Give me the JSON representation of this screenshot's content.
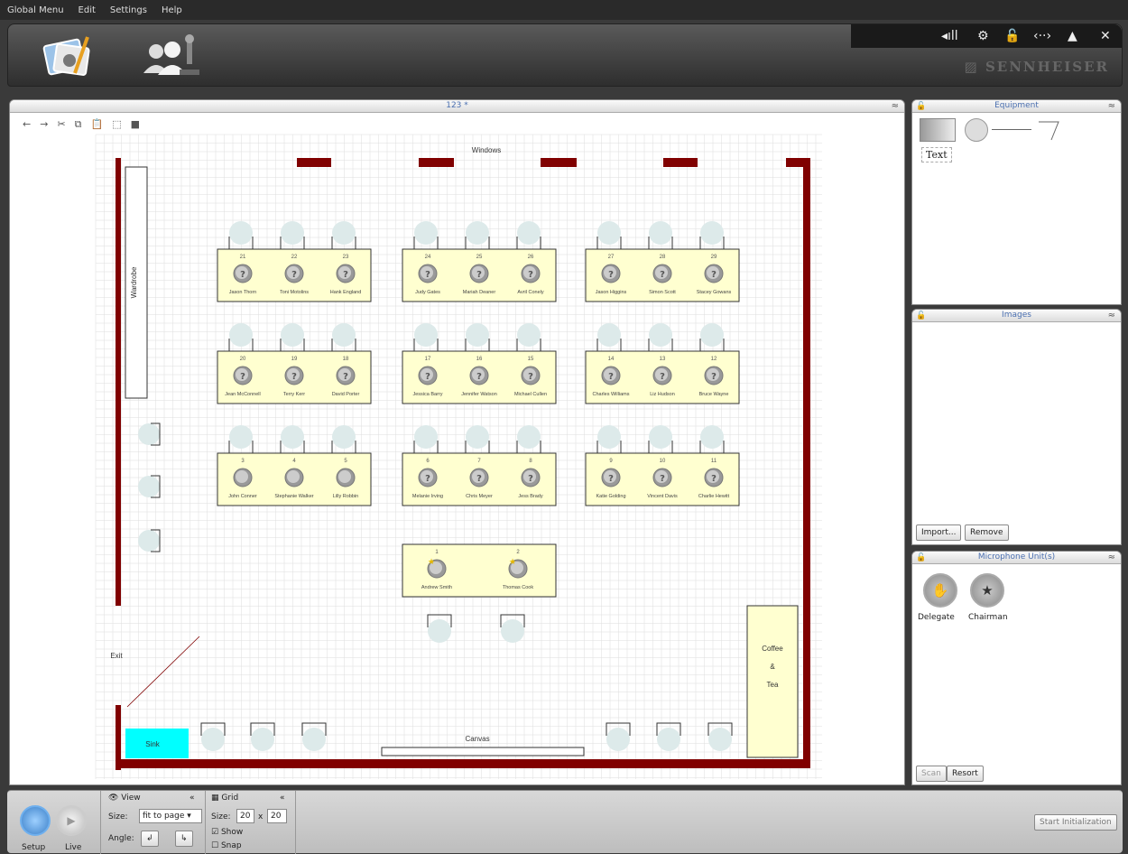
{
  "menu": [
    "Global Menu",
    "Edit",
    "Settings",
    "Help"
  ],
  "brand": "SENNHEISER",
  "main": {
    "title": "123 *"
  },
  "room": {
    "windows": "Windows",
    "wardrobe": "Wardrobe",
    "exit": "Exit",
    "sink": "Sink",
    "canvas": "Canvas",
    "coffee": [
      "Coffee",
      "&",
      "Tea"
    ]
  },
  "tables": [
    {
      "seats": [
        {
          "n": "21",
          "name": "Jason Thorn",
          "q": true
        },
        {
          "n": "22",
          "name": "Toni Motolins",
          "q": true
        },
        {
          "n": "23",
          "name": "Hank England",
          "q": true
        }
      ]
    },
    {
      "seats": [
        {
          "n": "24",
          "name": "Judy Gates",
          "q": true
        },
        {
          "n": "25",
          "name": "Mariah Deaner",
          "q": true
        },
        {
          "n": "26",
          "name": "Avril Conely",
          "q": true
        }
      ]
    },
    {
      "seats": [
        {
          "n": "27",
          "name": "Jason Higgins",
          "q": true
        },
        {
          "n": "28",
          "name": "Simon Scott",
          "q": true
        },
        {
          "n": "29",
          "name": "Stacey Gowans",
          "q": true
        }
      ]
    },
    {
      "seats": [
        {
          "n": "20",
          "name": "Jean McConnell",
          "q": true
        },
        {
          "n": "19",
          "name": "Terry Kerr",
          "q": true
        },
        {
          "n": "18",
          "name": "David Porter",
          "q": true
        }
      ]
    },
    {
      "seats": [
        {
          "n": "17",
          "name": "Jessica Barry",
          "q": true
        },
        {
          "n": "16",
          "name": "Jennifer Watson",
          "q": true
        },
        {
          "n": "15",
          "name": "Michael Cullen",
          "q": true
        }
      ]
    },
    {
      "seats": [
        {
          "n": "14",
          "name": "Charles Williams",
          "q": true
        },
        {
          "n": "13",
          "name": "Liz Hudson",
          "q": true
        },
        {
          "n": "12",
          "name": "Bruce Wayne",
          "q": true
        }
      ]
    },
    {
      "seats": [
        {
          "n": "3",
          "name": "John Conner",
          "q": false
        },
        {
          "n": "4",
          "name": "Stephanie Walker",
          "q": false
        },
        {
          "n": "5",
          "name": "Lilly Robbin",
          "q": false
        }
      ]
    },
    {
      "seats": [
        {
          "n": "6",
          "name": "Melanie Irving",
          "q": true
        },
        {
          "n": "7",
          "name": "Chris Meyer",
          "q": true
        },
        {
          "n": "8",
          "name": "Jess Brady",
          "q": true
        }
      ]
    },
    {
      "seats": [
        {
          "n": "9",
          "name": "Katie Golding",
          "q": true
        },
        {
          "n": "10",
          "name": "Vincent Davis",
          "q": true
        },
        {
          "n": "11",
          "name": "Charlie Hewitt",
          "q": true
        }
      ]
    },
    {
      "seats": [
        {
          "n": "1",
          "name": "Andrew Smith",
          "q": false,
          "star": true
        },
        {
          "n": "2",
          "name": "Thomas Cook",
          "q": false,
          "star": true
        }
      ]
    }
  ],
  "equipment": {
    "title": "Equipment",
    "text_tool": "Text"
  },
  "images": {
    "title": "Images",
    "import": "Import...",
    "remove": "Remove"
  },
  "mics": {
    "title": "Microphone Unit(s)",
    "delegate": "Delegate",
    "chairman": "Chairman",
    "scan": "Scan",
    "resort": "Resort"
  },
  "bottom": {
    "setup": "Setup",
    "live": "Live",
    "view": {
      "title": "View",
      "size_label": "Size:",
      "size_value": "fit to page",
      "angle_label": "Angle:"
    },
    "grid": {
      "title": "Grid",
      "size_label": "Size:",
      "w": "20",
      "x": "x",
      "h": "20",
      "show": "Show",
      "snap": "Snap",
      "show_checked": true,
      "snap_checked": false
    },
    "start": "Start Initialization"
  },
  "colors": {
    "wall": "#800000",
    "table": "#ffffd0",
    "sink": "#00ffff",
    "link": "#4a6fb0"
  }
}
